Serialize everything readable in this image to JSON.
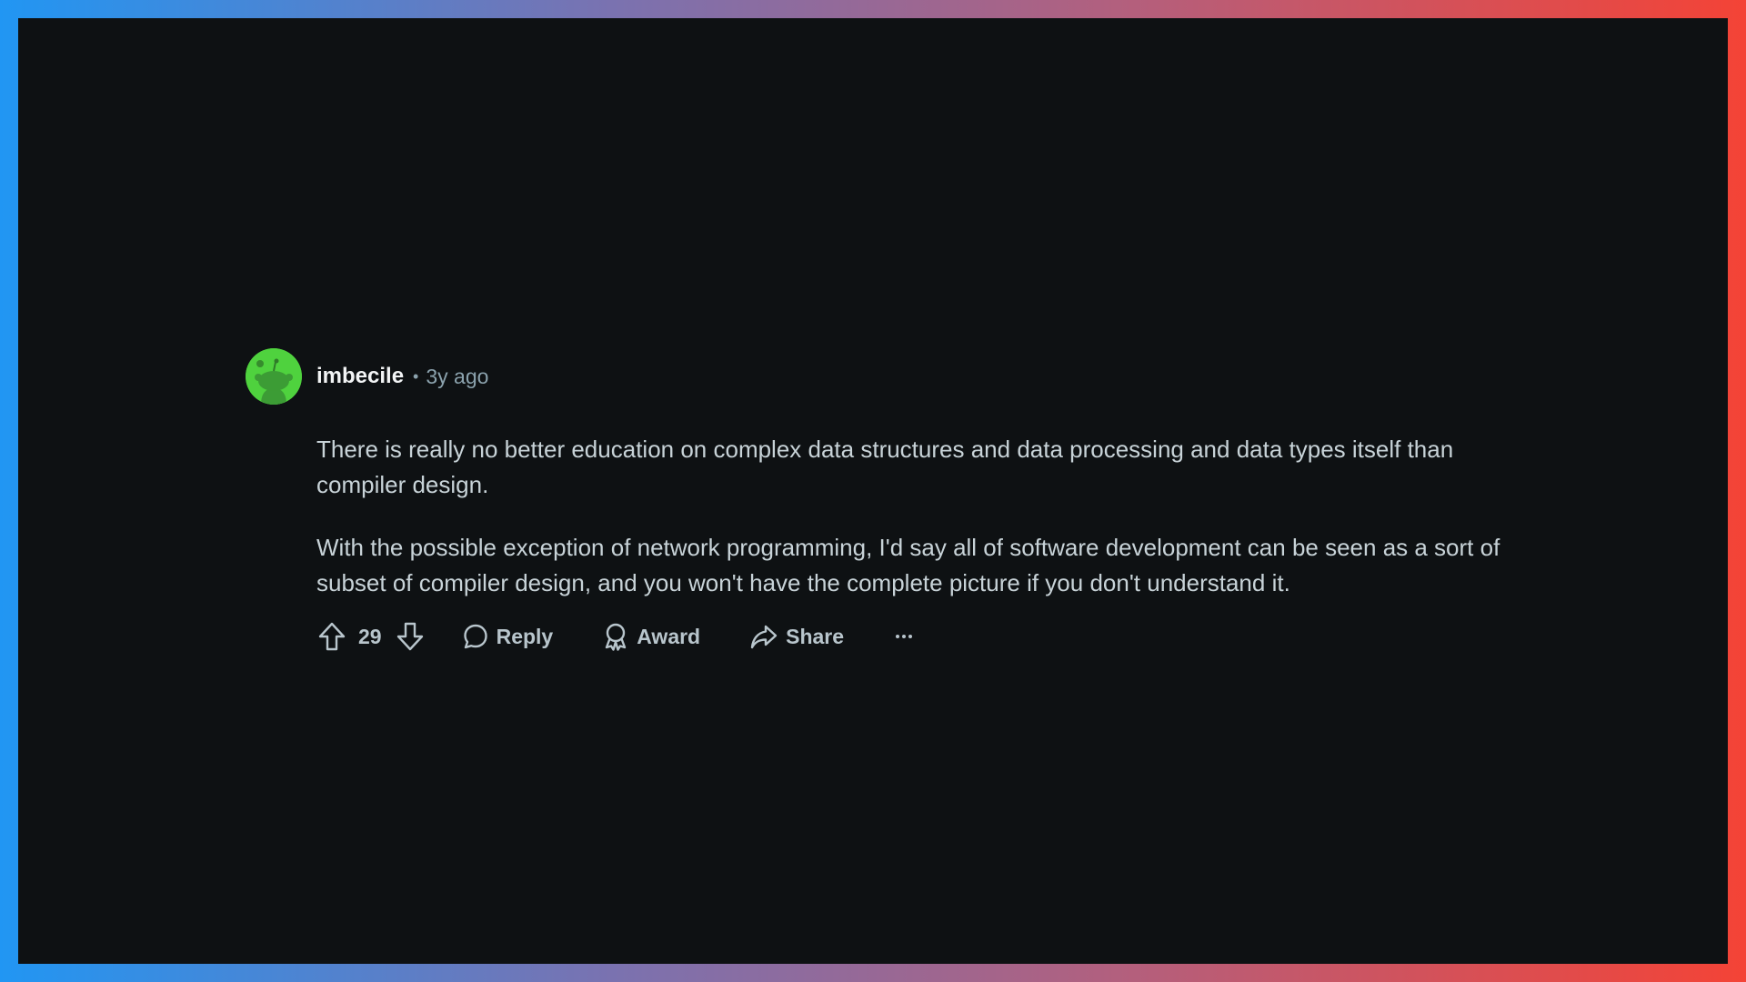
{
  "comment": {
    "author": "imbecile",
    "separator": "•",
    "age": "3y ago",
    "avatar_color": "#4fd23e",
    "paragraphs": [
      "There is really no better education on complex data structures and data processing and data types itself than compiler design.",
      "With the possible exception of network programming, I'd say all of software development can be seen as a sort of subset of compiler design, and you won't have the complete picture if you don't understand it."
    ],
    "score": "29",
    "actions": {
      "reply_label": "Reply",
      "award_label": "Award",
      "share_label": "Share"
    },
    "icons": [
      "upvote-icon",
      "downvote-icon",
      "comment-bubble-icon",
      "award-ribbon-icon",
      "share-arrow-icon",
      "more-options-icon"
    ]
  }
}
